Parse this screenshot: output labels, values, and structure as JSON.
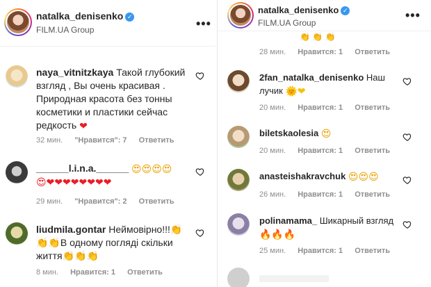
{
  "left": {
    "header": {
      "username": "natalka_denisenko",
      "subtitle": "FILM.UA Group",
      "more": "•••"
    },
    "comments": [
      {
        "user": "naya_vitnitzkaya",
        "text_line1": "Такой глубокий",
        "text_rest": "взгляд , Вы очень красивая . Природная красота без тонны косметики и пластики сейчас редкость",
        "emoji": "❤",
        "time": "32 мин.",
        "likes": "\"Нравится\": 7",
        "reply": "Ответить"
      },
      {
        "user": "______l.i.n.a.______",
        "emoji_line1": "😍😍😍😍",
        "emoji_line2": "😍❤❤❤❤❤❤❤❤",
        "time": "29 мин.",
        "likes": "\"Нравится\": 2",
        "reply": "Ответить"
      },
      {
        "user": "liudmila.gontar",
        "text_line1": "Неймовірно!!!👏",
        "text_line2": "👏👏В одному погляді скільки",
        "text_line3": "життя👏👏👏",
        "time": "8 мин.",
        "likes": "Нравится: 1",
        "reply": "Ответить"
      }
    ]
  },
  "right": {
    "header": {
      "username": "natalka_denisenko",
      "subtitle": "FILM.UA Group",
      "more": "•••"
    },
    "top_meta": {
      "time": "28 мин.",
      "likes": "Нравится: 1",
      "reply": "Ответить"
    },
    "comments": [
      {
        "user": "2fan_natalka_denisenko",
        "text": "Наш лучик",
        "emoji": "🌞❤",
        "time": "20 мин.",
        "likes": "Нравится: 1",
        "reply": "Ответить"
      },
      {
        "user": "biletskaolesia",
        "emoji": "😍",
        "time": "20 мин.",
        "likes": "Нравится: 1",
        "reply": "Ответить"
      },
      {
        "user": "anasteishakravchuk",
        "emoji": "😍😍😍",
        "time": "26 мин.",
        "likes": "Нравится: 1",
        "reply": "Ответить"
      },
      {
        "user": "polinamama_",
        "text": "Шикарный взгляд",
        "emoji": "🔥🔥🔥",
        "time": "25 мин.",
        "likes": "Нравится: 1",
        "reply": "Ответить"
      }
    ]
  },
  "colors": {
    "text": "#262626",
    "meta": "#8e8e8e",
    "verified": "#3897f0",
    "heart": "#ed1c24"
  }
}
